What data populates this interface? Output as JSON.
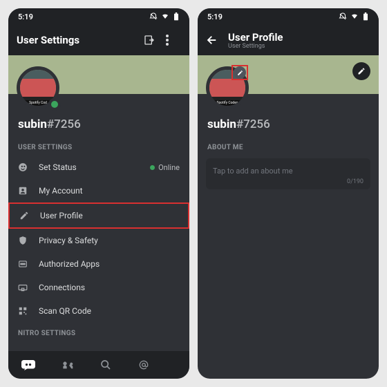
{
  "statusbar": {
    "time": "5:19"
  },
  "left": {
    "title": "User Settings",
    "avatar_caption": "Spotify Cod",
    "username": "subin",
    "discriminator": "#7256",
    "section1": "USER SETTINGS",
    "items": [
      {
        "icon": "status",
        "label": "Set Status",
        "value": "Online",
        "interact": true,
        "hl": false
      },
      {
        "icon": "account",
        "label": "My Account",
        "value": "",
        "interact": true,
        "hl": false
      },
      {
        "icon": "pencil",
        "label": "User Profile",
        "value": "",
        "interact": true,
        "hl": true
      },
      {
        "icon": "shield",
        "label": "Privacy & Safety",
        "value": "",
        "interact": true,
        "hl": false
      },
      {
        "icon": "apps",
        "label": "Authorized Apps",
        "value": "",
        "interact": true,
        "hl": false
      },
      {
        "icon": "link",
        "label": "Connections",
        "value": "",
        "interact": true,
        "hl": false
      },
      {
        "icon": "qr",
        "label": "Scan QR Code",
        "value": "",
        "interact": true,
        "hl": false
      }
    ],
    "section2": "NITRO SETTINGS"
  },
  "right": {
    "title": "User Profile",
    "subtitle": "User Settings",
    "avatar_caption": "Spotify Codes",
    "username": "subin",
    "discriminator": "#7256",
    "about_label": "ABOUT ME",
    "about_placeholder": "Tap to add an about me",
    "about_count": "0/190"
  }
}
